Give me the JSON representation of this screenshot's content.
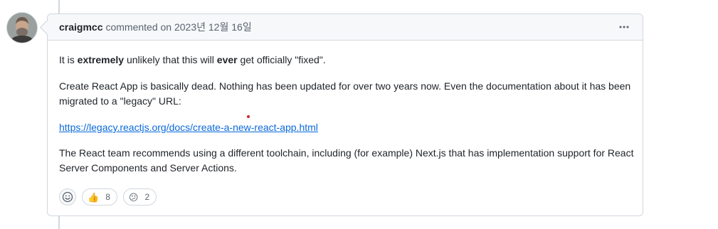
{
  "comment": {
    "author": "craigmcc",
    "action": "commented on",
    "date": "2023년 12월 16일",
    "menu_icon": "kebab-horizontal-icon",
    "body": {
      "p1": {
        "part1": "It is ",
        "bold1": "extremely",
        "part2": " unlikely that this will ",
        "bold2": "ever",
        "part3": " get officially \"fixed\"."
      },
      "p2": "Create React App is basically dead. Nothing has been updated for over two years now. Even the documentation about it has been migrated to a \"legacy\" URL:",
      "link": "https://legacy.reactjs.org/docs/create-a-new-react-app.html",
      "p4": "The React team recommends using a different toolchain, including (for example) Next.js that has implementation support for React Server Components and Server Actions."
    },
    "reactions": [
      {
        "icon": "thumbs-up-icon",
        "emoji": "👍",
        "count": "8"
      },
      {
        "icon": "confused-face-icon",
        "emoji": "😕",
        "count": "2"
      }
    ]
  },
  "colors": {
    "link": "#0969da",
    "border": "#d0d7de",
    "header_bg": "#f6f8fa",
    "muted_text": "#59636e"
  }
}
